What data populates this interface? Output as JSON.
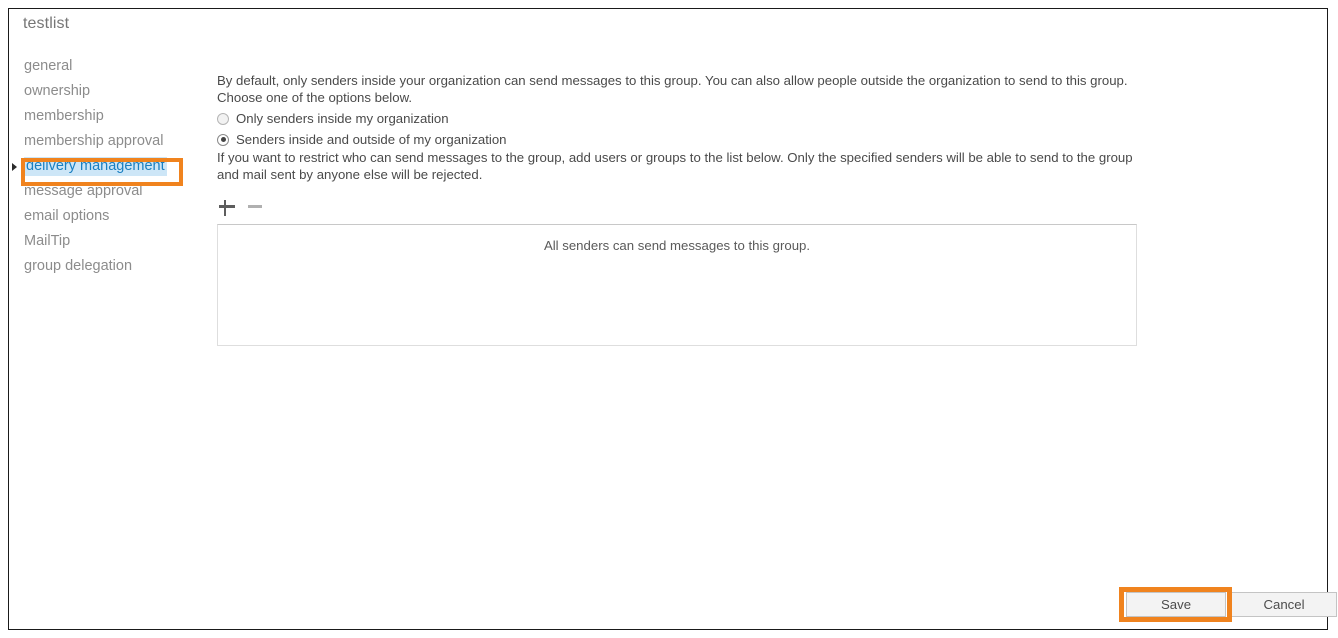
{
  "window": {
    "title": "testlist"
  },
  "sidebar": {
    "items": [
      {
        "label": "general",
        "selected": false
      },
      {
        "label": "ownership",
        "selected": false
      },
      {
        "label": "membership",
        "selected": false
      },
      {
        "label": "membership approval",
        "selected": false
      },
      {
        "label": "delivery management",
        "selected": true
      },
      {
        "label": "message approval",
        "selected": false
      },
      {
        "label": "email options",
        "selected": false
      },
      {
        "label": "MailTip",
        "selected": false
      },
      {
        "label": "group delegation",
        "selected": false
      }
    ]
  },
  "main": {
    "intro_paragraph": "By default, only senders inside your organization can send messages to this group. You can also allow people outside the organization to send to this group. Choose one of the options below.",
    "radio_options": [
      {
        "label": "Only senders inside my organization",
        "checked": false
      },
      {
        "label": "Senders inside and outside of my organization",
        "checked": true
      }
    ],
    "restrict_paragraph": "If you want to restrict who can send messages to the group, add users or groups to the list below. Only the specified senders will be able to send to the group and mail sent by anyone else will be rejected.",
    "toolbar": {
      "add_icon": "plus-icon",
      "remove_icon": "minus-icon"
    },
    "listbox": {
      "empty_message": "All senders can send messages to this group.",
      "items": []
    }
  },
  "footer": {
    "save_label": "Save",
    "cancel_label": "Cancel"
  },
  "annotations": {
    "highlight_color": "#f0831e",
    "selection_color": "#cde6f7",
    "selected_nav_text_color": "#1a7fc1"
  }
}
